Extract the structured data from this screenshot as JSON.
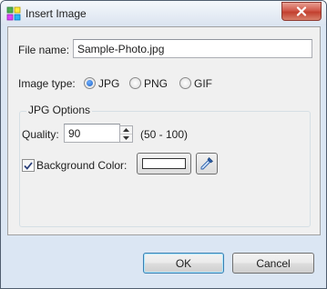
{
  "window": {
    "title": "Insert Image",
    "app_icon": "image-app-icon",
    "close_icon": "close-icon"
  },
  "file_name": {
    "label": "File name:",
    "value": "Sample-Photo.jpg"
  },
  "image_type": {
    "label": "Image type:",
    "options": [
      {
        "label": "JPG",
        "checked": true
      },
      {
        "label": "PNG",
        "checked": false
      },
      {
        "label": "GIF",
        "checked": false
      }
    ]
  },
  "jpg_options": {
    "title": "JPG Options",
    "quality_label": "Quality:",
    "quality_value": "90",
    "quality_range": "(50 - 100)",
    "background_color_label": "Background Color:",
    "background_color_checked": true,
    "background_color_value": "#ffffff",
    "picker_icon": "eyedropper-icon"
  },
  "buttons": {
    "ok": "OK",
    "cancel": "Cancel"
  },
  "colors": {
    "accent": "#1b5fc4",
    "dialog_bg": "#f0f0f0",
    "frame": "#dbe6f3",
    "close": "#c2402f"
  }
}
